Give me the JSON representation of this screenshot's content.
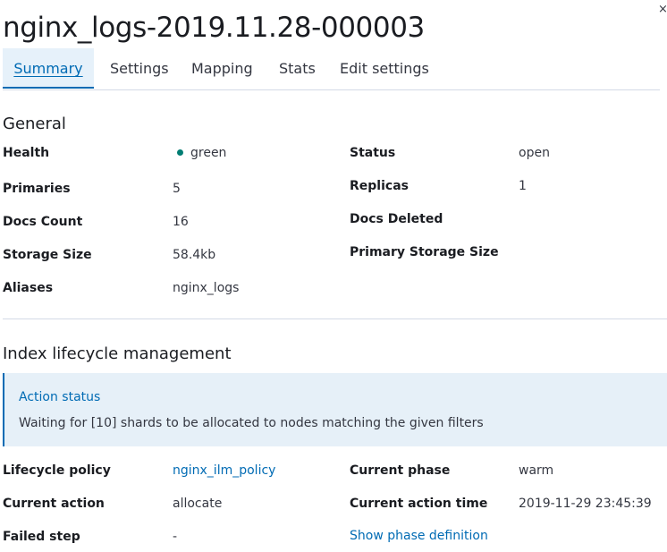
{
  "close_label": "×",
  "title": "nginx_logs-2019.11.28-000003",
  "tabs": [
    {
      "label": "Summary",
      "active": true
    },
    {
      "label": "Settings",
      "active": false
    },
    {
      "label": "Mapping",
      "active": false
    },
    {
      "label": "Stats",
      "active": false
    },
    {
      "label": "Edit settings",
      "active": false
    }
  ],
  "general": {
    "title": "General",
    "health_label": "Health",
    "health_value": "green",
    "status_label": "Status",
    "status_value": "open",
    "primaries_label": "Primaries",
    "primaries_value": "5",
    "replicas_label": "Replicas",
    "replicas_value": "1",
    "docs_count_label": "Docs Count",
    "docs_count_value": "16",
    "docs_deleted_label": "Docs Deleted",
    "docs_deleted_value": "",
    "storage_size_label": "Storage Size",
    "storage_size_value": "58.4kb",
    "primary_storage_size_label": "Primary Storage Size",
    "primary_storage_size_value": "",
    "aliases_label": "Aliases",
    "aliases_value": "nginx_logs"
  },
  "ilm": {
    "title": "Index lifecycle management",
    "callout_title": "Action status",
    "callout_body": "Waiting for [10] shards to be allocated to nodes matching the given filters",
    "lifecycle_policy_label": "Lifecycle policy",
    "lifecycle_policy_value": "nginx_ilm_policy",
    "current_phase_label": "Current phase",
    "current_phase_value": "warm",
    "current_action_label": "Current action",
    "current_action_value": "allocate",
    "current_action_time_label": "Current action time",
    "current_action_time_value": "2019-11-29 23:45:39",
    "failed_step_label": "Failed step",
    "failed_step_value": "-",
    "show_phase_definition_label": "Show phase definition"
  },
  "colors": {
    "accent": "#006bb4",
    "health_green": "#017d73",
    "callout_bg": "#e6f0f8"
  }
}
